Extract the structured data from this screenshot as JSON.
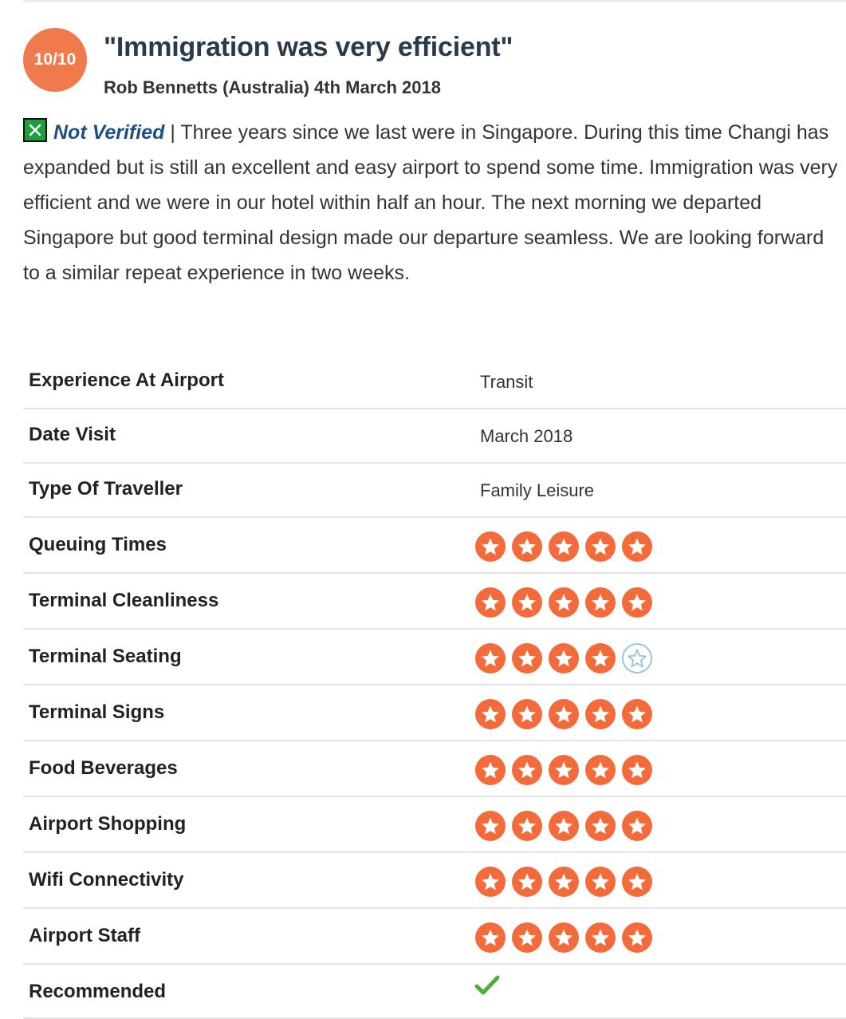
{
  "review": {
    "score": "10/10",
    "title": "\"Immigration was very efficient\"",
    "byline": "Rob Bennetts (Australia) 4th March 2018",
    "verified_label": "Not Verified",
    "separator": " | ",
    "body": "Three years since we last were in Singapore. During this time Changi has expanded but is still an excellent and easy airport to spend some time. Immigration was very efficient and we were in our hotel within half an hour. The next morning we departed Singapore but good terminal design made our departure seamless. We are looking forward to a similar repeat experience in two weeks."
  },
  "details": [
    {
      "label": "Experience At Airport",
      "value": "Transit"
    },
    {
      "label": "Date Visit",
      "value": "March 2018"
    },
    {
      "label": "Type Of Traveller",
      "value": "Family Leisure"
    }
  ],
  "ratings": [
    {
      "label": "Queuing Times",
      "stars": 5
    },
    {
      "label": "Terminal Cleanliness",
      "stars": 5
    },
    {
      "label": "Terminal Seating",
      "stars": 4
    },
    {
      "label": "Terminal Signs",
      "stars": 5
    },
    {
      "label": "Food Beverages",
      "stars": 5
    },
    {
      "label": "Airport Shopping",
      "stars": 5
    },
    {
      "label": "Wifi Connectivity",
      "stars": 5
    },
    {
      "label": "Airport Staff",
      "stars": 5
    }
  ],
  "recommended": {
    "label": "Recommended",
    "icon": "check-icon",
    "value": true
  },
  "colors": {
    "badge": "#f07a4c",
    "star_filled": "#f36b3b",
    "star_empty": "#9cc3e4",
    "check": "#4caf3d"
  },
  "icons": {
    "verification": "x-box-icon",
    "rating": "star-icon"
  }
}
